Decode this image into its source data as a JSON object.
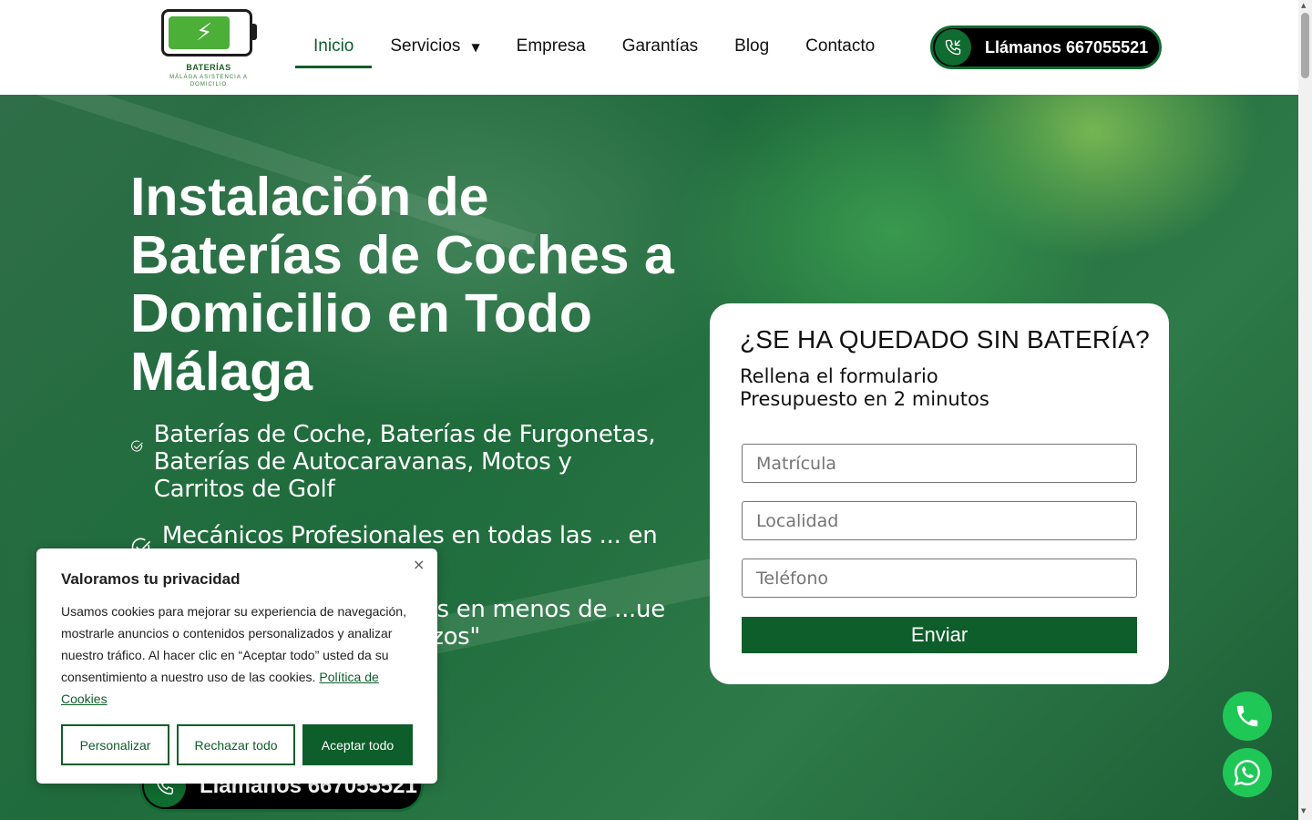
{
  "logo": {
    "title": "BATERÍAS",
    "subtitle": "MÁLAGA ASISTENCIA A DOMICILIO"
  },
  "nav": {
    "items": [
      {
        "label": "Inicio"
      },
      {
        "label": "Servicios"
      },
      {
        "label": "Empresa"
      },
      {
        "label": "Garantías"
      },
      {
        "label": "Blog"
      },
      {
        "label": "Contacto"
      }
    ],
    "active": "Inicio"
  },
  "header_call": {
    "label": "Llámanos 667055521"
  },
  "hero": {
    "title": "Instalación de Baterías de Coches a Domicilio en Todo Málaga",
    "features": [
      {
        "text": "Baterías de Coche, Baterías de Furgonetas, Baterías de Autocaravanas, Motos y Carritos de Golf"
      },
      {
        "text": "Mecánicos Profesionales en todas las ... en a su Domicilio ."
      },
      {
        "text": "...s su batería esté ...ress en menos de ...ue mejor le venga. ...inchazos\""
      }
    ],
    "call": {
      "label": "Llámanos 667055521"
    }
  },
  "form": {
    "title": "¿SE HA QUEDADO SIN BATERÍA?",
    "subtitle_line1": "Rellena el formulario",
    "subtitle_line2": "Presupuesto en 2 minutos",
    "fields": [
      {
        "placeholder": "Matrícula"
      },
      {
        "placeholder": "Localidad"
      },
      {
        "placeholder": "Teléfono"
      }
    ],
    "submit": "Enviar"
  },
  "cookie": {
    "title": "Valoramos tu privacidad",
    "text": "Usamos cookies para mejorar su experiencia de navegación, mostrarle anuncios o contenidos personalizados y analizar nuestro tráfico. Al hacer clic en “Aceptar todo” usted da su consentimiento a nuestro uso de las cookies.",
    "link": "Política de Cookies",
    "close": "×",
    "buttons": {
      "customize": "Personalizar",
      "reject": "Rechazar todo",
      "accept": "Aceptar todo"
    }
  },
  "floating": {
    "phone_icon": "phone-icon",
    "whatsapp_icon": "whatsapp-icon"
  },
  "colors": {
    "brand_green": "#0d5e2a",
    "logo_green": "#4caf37",
    "float_green": "#1fc757",
    "black": "#000000"
  }
}
